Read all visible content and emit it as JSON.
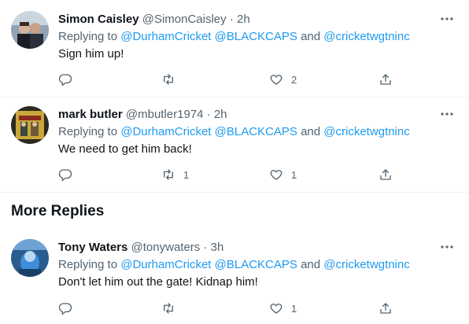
{
  "section": {
    "more_replies": "More Replies"
  },
  "tweets": [
    {
      "name": "Simon Caisley",
      "handle": "@SimonCaisley",
      "dot": "·",
      "time": "2h",
      "replying_prefix": "Replying to",
      "mention1": "@DurhamCricket",
      "mention2": "@BLACKCAPS",
      "and": "and",
      "mention3": "@cricketwgtninc",
      "text": "Sign him up!",
      "reply_count": "",
      "retweet_count": "",
      "like_count": "2"
    },
    {
      "name": "mark butler",
      "handle": "@mbutler1974",
      "dot": "·",
      "time": "2h",
      "replying_prefix": "Replying to",
      "mention1": "@DurhamCricket",
      "mention2": "@BLACKCAPS",
      "and": "and",
      "mention3": "@cricketwgtninc",
      "text": "We need to get him back!",
      "reply_count": "",
      "retweet_count": "1",
      "like_count": "1"
    },
    {
      "name": "Tony Waters",
      "handle": "@tonywaters",
      "dot": "·",
      "time": "3h",
      "replying_prefix": "Replying to",
      "mention1": "@DurhamCricket",
      "mention2": "@BLACKCAPS",
      "and": "and",
      "mention3": "@cricketwgtninc",
      "text": "Don't let him out the gate! Kidnap him!",
      "reply_count": "",
      "retweet_count": "",
      "like_count": "1"
    }
  ],
  "icons": {
    "reply": "reply-icon",
    "retweet": "retweet-icon",
    "like": "heart-icon",
    "share": "share-icon",
    "more": "more-icon"
  },
  "colors": {
    "link": "#1d9bf0",
    "secondary": "#536471",
    "text": "#0f1419"
  }
}
